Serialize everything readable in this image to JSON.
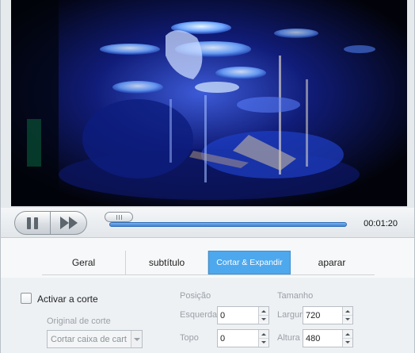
{
  "player": {
    "time": "00:01:20",
    "progress_fraction": 0.05,
    "play_icon": "pause-icon",
    "fwd_icon": "fast-forward-icon"
  },
  "tabs": [
    {
      "label": "Geral",
      "active": false
    },
    {
      "label": "subtítulo",
      "active": false
    },
    {
      "label": "Cortar & Expandir",
      "active": true
    },
    {
      "label": "aparar",
      "active": false
    }
  ],
  "crop": {
    "activate_label": "Activar a corte",
    "activate_checked": false,
    "source_label": "Original de corte",
    "source_value": "Cortar caixa de cart",
    "position_header": "Posição",
    "left_label": "Esquerda",
    "left_value": "0",
    "top_label": "Topo",
    "top_value": "0",
    "size_header": "Tamanho",
    "width_label": "Largur",
    "width_value": "720",
    "height_label": "Altura",
    "height_value": "480"
  },
  "colors": {
    "active_tab": "#4da8ee",
    "seek_fill": "#3b82d8"
  }
}
